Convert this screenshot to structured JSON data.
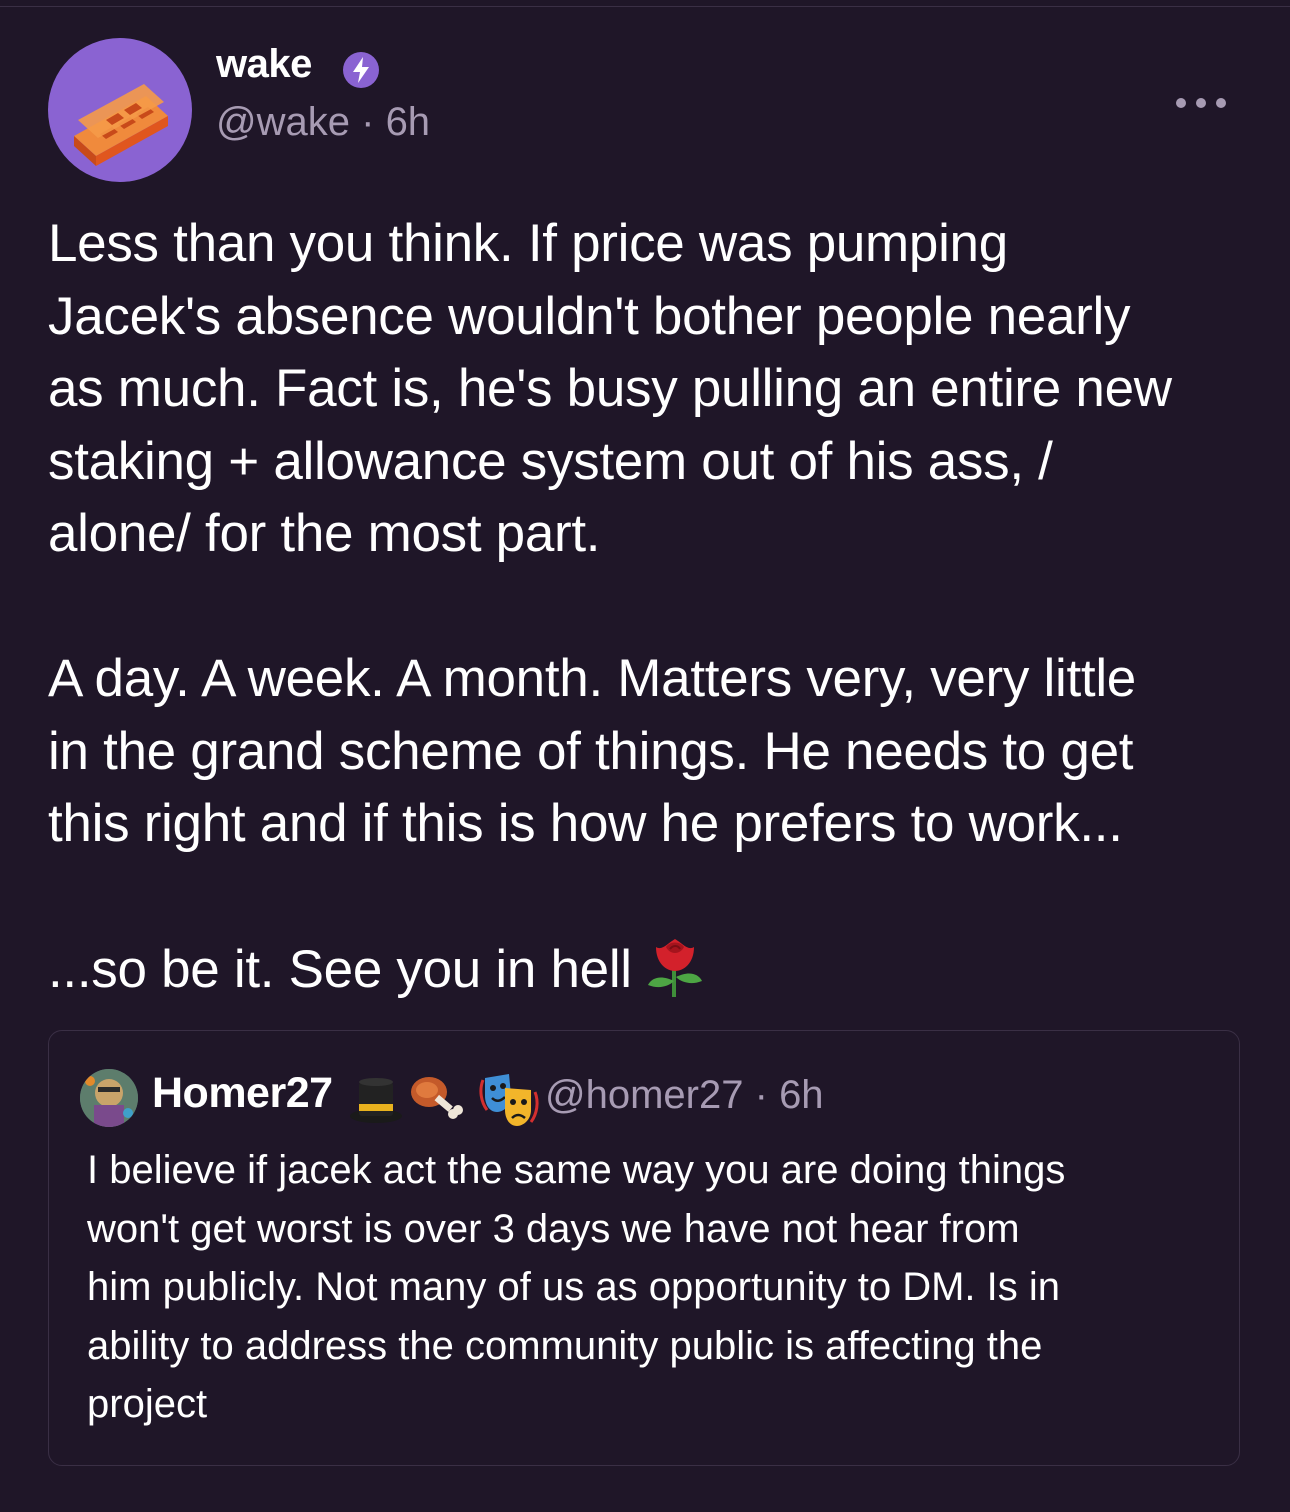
{
  "colors": {
    "background": "#1f1628",
    "muted_text": "#a79bb3",
    "avatar_bg": "#8a63d2",
    "badge": "#8a63d2",
    "border": "#3a2f45"
  },
  "post": {
    "author": {
      "display_name": "wake",
      "handle": "@wake",
      "separator": "·",
      "time": "6h",
      "avatar_icon": "brick-icon",
      "badge_icon": "lightning-badge-icon"
    },
    "more_icon": "more-horizontal-icon",
    "paragraphs": [
      [
        "Less than you think. If price was pumping",
        "Jacek's absence wouldn't bother people nearly",
        "as much. Fact is, he's busy pulling an entire new",
        "staking + allowance system out of his ass, /",
        "alone/ for the most part."
      ],
      [
        "A day. A week. A month. Matters very, very little",
        "in the grand scheme of things. He needs to get",
        "this right and if this is how he prefers to work..."
      ],
      [
        "...so be it. See you in hell"
      ]
    ],
    "end_emoji": "rose-icon"
  },
  "quote": {
    "author": {
      "display_name": "Homer27",
      "name_emojis": [
        "top-hat-icon",
        "meat-on-bone-icon",
        "performing-arts-icon"
      ],
      "handle": "@homer27",
      "separator": "·",
      "time": "6h"
    },
    "lines": [
      "I believe if jacek act the same way you are doing things",
      "won't get worst is over 3 days we have not hear from",
      "him publicly. Not many of us as opportunity to DM. Is in",
      "ability to address the community public is affecting the",
      "project"
    ]
  }
}
